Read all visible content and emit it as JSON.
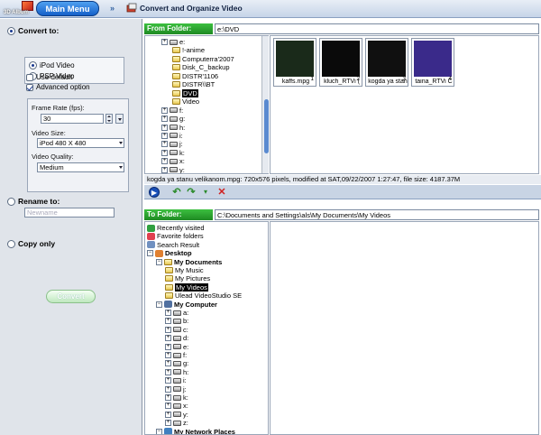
{
  "app": {
    "logo_text": "3D Album",
    "main_menu": "Main Menu",
    "title": "Convert and Organize Video"
  },
  "options": {
    "convert_to": "Convert to:",
    "formats": [
      "iPod Video",
      "PSP Video"
    ],
    "use_default": "Use default",
    "advanced_option": "Advanced option",
    "frame_rate_label": "Frame Rate (fps):",
    "frame_rate_value": "30",
    "video_size_label": "Video Size:",
    "video_size_value": "iPod 480 X 480",
    "video_quality_label": "Video Quality:",
    "video_quality_value": "Medium",
    "rename_to": "Rename to:",
    "rename_placeholder": "Newname",
    "copy_only": "Copy only",
    "convert_button": "Convert"
  },
  "from": {
    "label": "From Folder:",
    "path": "e:\\DVD",
    "tree": [
      {
        "name": "e:",
        "kind": "drive"
      },
      {
        "name": "!-anime",
        "kind": "folder"
      },
      {
        "name": "Computerra'2007",
        "kind": "folder"
      },
      {
        "name": "Disk_C_backup",
        "kind": "folder"
      },
      {
        "name": "DISTR'1106",
        "kind": "folder"
      },
      {
        "name": "DISTR\\\\BT",
        "kind": "folder"
      },
      {
        "name": "DVD",
        "kind": "folder",
        "selected": true
      },
      {
        "name": "Video",
        "kind": "folder"
      },
      {
        "name": "f:",
        "kind": "drive"
      },
      {
        "name": "g:",
        "kind": "drive"
      },
      {
        "name": "h:",
        "kind": "drive"
      },
      {
        "name": "i:",
        "kind": "drive"
      },
      {
        "name": "j:",
        "kind": "drive"
      },
      {
        "name": "k:",
        "kind": "drive"
      },
      {
        "name": "x:",
        "kind": "drive"
      },
      {
        "name": "y:",
        "kind": "drive"
      }
    ],
    "files": [
      {
        "name": "kaffs.mpg",
        "num": "1",
        "color": "#1a2a1a"
      },
      {
        "name": "kluch_RTVi (",
        "num": "2",
        "color": "#0a0a0a"
      },
      {
        "name": "kogda ya stan",
        "num": "3",
        "color": "#101010"
      },
      {
        "name": "taina_RTVi C",
        "num": "4",
        "color": "#3a2a8a"
      }
    ],
    "status": "kogda ya stanu velikanom.mpg: 720x576 pixels, modified at SAT,09/22/2007 1:27:47, file size: 4187.37M"
  },
  "to": {
    "label": "To Folder:",
    "path": "C:\\Documents and Settings\\als\\My Documents\\My Videos",
    "tree": [
      {
        "name": "Recently visited",
        "kind": "recent",
        "indent": 0
      },
      {
        "name": "Favorite folders",
        "kind": "fav",
        "indent": 0
      },
      {
        "name": "Search Result",
        "kind": "search",
        "indent": 0
      },
      {
        "name": "Desktop",
        "kind": "desktop",
        "indent": 0,
        "bold": true
      },
      {
        "name": "My Documents",
        "kind": "folder",
        "indent": 1,
        "bold": true
      },
      {
        "name": "My Music",
        "kind": "folder",
        "indent": 2
      },
      {
        "name": "My Pictures",
        "kind": "folder",
        "indent": 2
      },
      {
        "name": "My Videos",
        "kind": "folder",
        "indent": 2,
        "selected": true
      },
      {
        "name": "Ulead VideoStudio SE",
        "kind": "folder",
        "indent": 2
      },
      {
        "name": "My Computer",
        "kind": "computer",
        "indent": 1,
        "bold": true
      },
      {
        "name": "a:",
        "kind": "drive",
        "indent": 2
      },
      {
        "name": "b:",
        "kind": "drive",
        "indent": 2
      },
      {
        "name": "c:",
        "kind": "drive",
        "indent": 2
      },
      {
        "name": "d:",
        "kind": "drive",
        "indent": 2
      },
      {
        "name": "e:",
        "kind": "drive",
        "indent": 2
      },
      {
        "name": "f:",
        "kind": "drive",
        "indent": 2
      },
      {
        "name": "g:",
        "kind": "drive",
        "indent": 2
      },
      {
        "name": "h:",
        "kind": "drive",
        "indent": 2
      },
      {
        "name": "i:",
        "kind": "drive",
        "indent": 2
      },
      {
        "name": "j:",
        "kind": "drive",
        "indent": 2
      },
      {
        "name": "k:",
        "kind": "drive",
        "indent": 2
      },
      {
        "name": "x:",
        "kind": "drive",
        "indent": 2
      },
      {
        "name": "y:",
        "kind": "drive",
        "indent": 2
      },
      {
        "name": "z:",
        "kind": "drive",
        "indent": 2
      },
      {
        "name": "My Network Places",
        "kind": "network",
        "indent": 1,
        "bold": true
      }
    ]
  },
  "colors": {
    "header_green": "#1e8a22",
    "accent_blue": "#1560c8"
  }
}
